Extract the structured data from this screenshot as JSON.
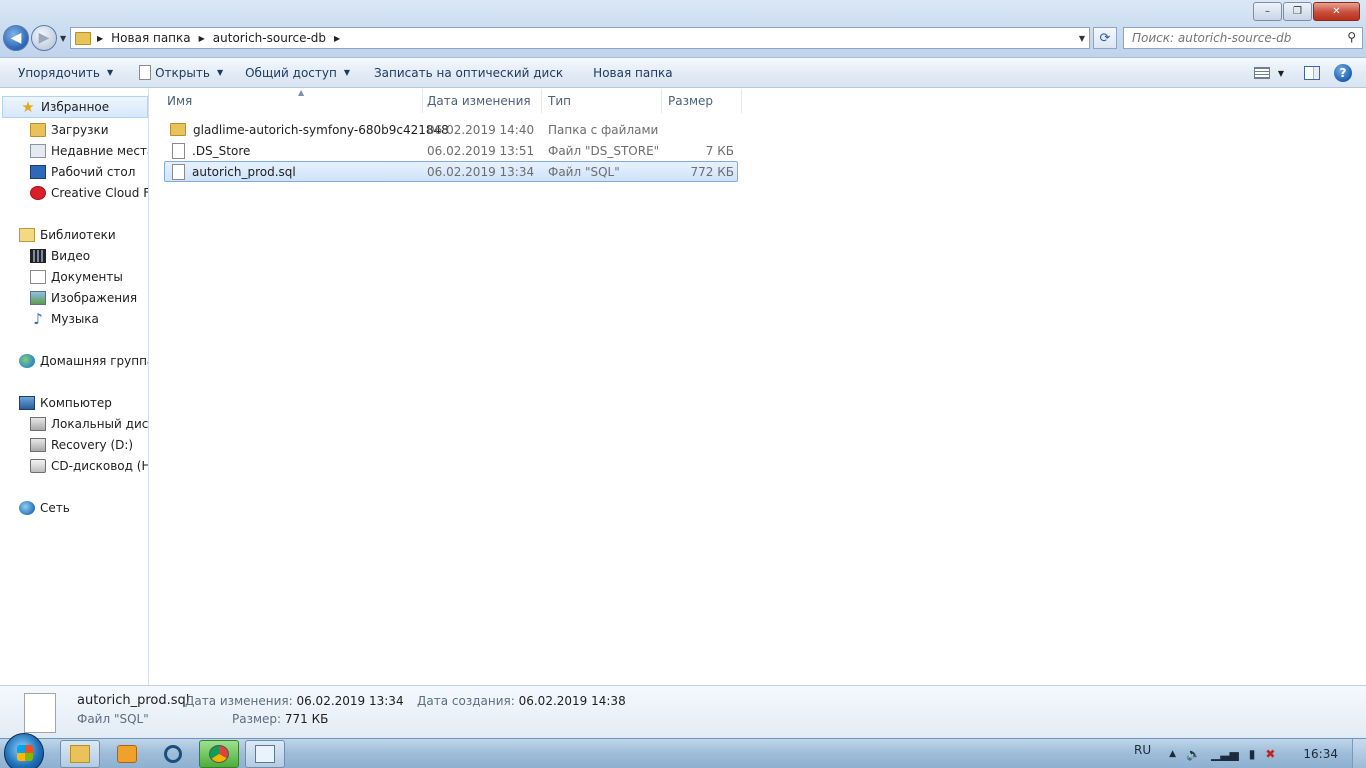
{
  "window": {
    "minimize_glyph": "–",
    "maximize_glyph": "❐",
    "close_glyph": "✕"
  },
  "address": {
    "breadcrumb": [
      "Новая папка",
      "autorich-source-db"
    ],
    "search_placeholder": "Поиск: autorich-source-db"
  },
  "toolbar": {
    "organize": "Упорядочить",
    "open": "Открыть",
    "share": "Общий доступ",
    "burn": "Записать на оптический диск",
    "new_folder": "Новая папка",
    "help": "?"
  },
  "navpane": {
    "favorites": "Избранное",
    "favorites_items": [
      "Загрузки",
      "Недавние места",
      "Рабочий стол",
      "Creative Cloud Files"
    ],
    "libraries": "Библиотеки",
    "libraries_items": [
      "Видео",
      "Документы",
      "Изображения",
      "Музыка"
    ],
    "homegroup": "Домашняя группа",
    "computer": "Компьютер",
    "computer_items": [
      "Локальный диск (C:)",
      "Recovery (D:)",
      "CD-дисковод (H:)"
    ],
    "network": "Сеть"
  },
  "columns": {
    "name": "Имя",
    "date": "Дата изменения",
    "type": "Тип",
    "size": "Размер"
  },
  "files": [
    {
      "name": "gladlime-autorich-symfony-680b9c421848",
      "date": "06.02.2019 14:40",
      "type": "Папка с файлами",
      "size": "",
      "kind": "folder"
    },
    {
      "name": ".DS_Store",
      "date": "06.02.2019 13:51",
      "type": "Файл \"DS_STORE\"",
      "size": "7 КБ",
      "kind": "file"
    },
    {
      "name": "autorich_prod.sql",
      "date": "06.02.2019 13:34",
      "type": "Файл \"SQL\"",
      "size": "772 КБ",
      "kind": "file",
      "selected": true
    }
  ],
  "details": {
    "filename": "autorich_prod.sql",
    "filetype": "Файл \"SQL\"",
    "modified_label": "Дата изменения:",
    "modified_value": "06.02.2019 13:34",
    "size_label": "Размер:",
    "size_value": "771 КБ",
    "created_label": "Дата создания:",
    "created_value": "06.02.2019 14:38"
  },
  "taskbar": {
    "lang": "RU",
    "clock": "16:34"
  }
}
